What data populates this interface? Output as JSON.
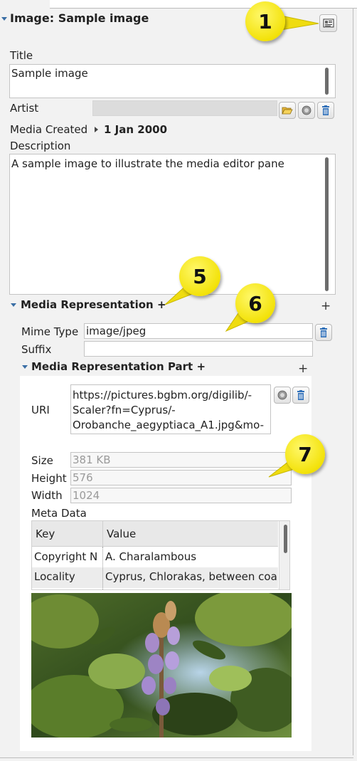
{
  "header": {
    "title": "Image: Sample image"
  },
  "fields": {
    "title_label": "Title",
    "title_value": "Sample image",
    "artist_label": "Artist",
    "media_created_label": "Media Created",
    "media_created_value": "1 Jan 2000",
    "description_label": "Description",
    "description_value": "A sample image to illustrate the media editor pane"
  },
  "representation": {
    "title": "Media Representation +",
    "add_label": "+",
    "mime_label": "Mime Type",
    "mime_value": "image/jpeg",
    "suffix_label": "Suffix",
    "suffix_value": ""
  },
  "part": {
    "title": "Media Representation Part +",
    "add_label": "+",
    "uri_label": "URI",
    "uri_lines": [
      "https://pictures.bgbm.org/digilib/-",
      "Scaler?fn=Cyprus/-",
      "Orobanche_aegyptiaca_A1.jpg&mo-"
    ],
    "size_label": "Size",
    "size_value": "381 KB",
    "height_label": "Height",
    "height_value": "576",
    "width_label": "Width",
    "width_value": "1024",
    "meta_label": "Meta Data"
  },
  "meta_table": {
    "columns": [
      "Key",
      "Value"
    ],
    "rows": [
      [
        "Copyright N",
        "A. Charalambous"
      ],
      [
        "Locality",
        "Cyprus, Chlorakas, between coa"
      ]
    ]
  },
  "callouts": [
    "1",
    "5",
    "6",
    "7"
  ],
  "icons": {
    "header": "id-card-icon",
    "artist_buttons": [
      "folder-open-icon",
      "disc-icon",
      "trash-icon"
    ],
    "mime_button": "trash-icon",
    "uri_buttons": [
      "disc-icon",
      "trash-icon"
    ]
  },
  "colors": {
    "accent": "#3a6ea5",
    "callout": "#f3e20a",
    "trash": "#2f6fb8"
  }
}
